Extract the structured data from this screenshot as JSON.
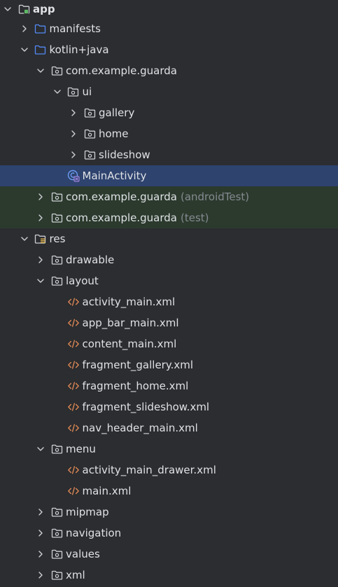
{
  "tree": [
    {
      "label": "app",
      "suffix": "",
      "depth": 0,
      "state": "expanded",
      "icon": "module-folder-icon",
      "style": "bold"
    },
    {
      "label": "manifests",
      "suffix": "",
      "depth": 1,
      "state": "collapsed",
      "icon": "blue-folder-icon",
      "style": ""
    },
    {
      "label": "kotlin+java",
      "suffix": "",
      "depth": 1,
      "state": "expanded",
      "icon": "blue-folder-icon",
      "style": ""
    },
    {
      "label": "com.example.guarda",
      "suffix": "",
      "depth": 2,
      "state": "expanded",
      "icon": "package-folder-icon",
      "style": ""
    },
    {
      "label": "ui",
      "suffix": "",
      "depth": 3,
      "state": "expanded",
      "icon": "package-folder-icon",
      "style": ""
    },
    {
      "label": "gallery",
      "suffix": "",
      "depth": 4,
      "state": "collapsed",
      "icon": "package-folder-icon",
      "style": ""
    },
    {
      "label": "home",
      "suffix": "",
      "depth": 4,
      "state": "collapsed",
      "icon": "package-folder-icon",
      "style": ""
    },
    {
      "label": "slideshow",
      "suffix": "",
      "depth": 4,
      "state": "collapsed",
      "icon": "package-folder-icon",
      "style": ""
    },
    {
      "label": "MainActivity",
      "suffix": "",
      "depth": 3,
      "state": "leaf",
      "icon": "kotlin-class-icon",
      "style": "selected"
    },
    {
      "label": "com.example.guarda",
      "suffix": "(androidTest)",
      "depth": 2,
      "state": "collapsed",
      "icon": "package-folder-icon",
      "style": "tinted"
    },
    {
      "label": "com.example.guarda",
      "suffix": "(test)",
      "depth": 2,
      "state": "collapsed",
      "icon": "package-folder-icon",
      "style": "tinted"
    },
    {
      "label": "res",
      "suffix": "",
      "depth": 1,
      "state": "expanded",
      "icon": "resources-folder-icon",
      "style": ""
    },
    {
      "label": "drawable",
      "suffix": "",
      "depth": 2,
      "state": "collapsed",
      "icon": "package-folder-icon",
      "style": ""
    },
    {
      "label": "layout",
      "suffix": "",
      "depth": 2,
      "state": "expanded",
      "icon": "package-folder-icon",
      "style": ""
    },
    {
      "label": "activity_main.xml",
      "suffix": "",
      "depth": 3,
      "state": "leaf",
      "icon": "xml-file-icon",
      "style": ""
    },
    {
      "label": "app_bar_main.xml",
      "suffix": "",
      "depth": 3,
      "state": "leaf",
      "icon": "xml-file-icon",
      "style": ""
    },
    {
      "label": "content_main.xml",
      "suffix": "",
      "depth": 3,
      "state": "leaf",
      "icon": "xml-file-icon",
      "style": ""
    },
    {
      "label": "fragment_gallery.xml",
      "suffix": "",
      "depth": 3,
      "state": "leaf",
      "icon": "xml-file-icon",
      "style": ""
    },
    {
      "label": "fragment_home.xml",
      "suffix": "",
      "depth": 3,
      "state": "leaf",
      "icon": "xml-file-icon",
      "style": ""
    },
    {
      "label": "fragment_slideshow.xml",
      "suffix": "",
      "depth": 3,
      "state": "leaf",
      "icon": "xml-file-icon",
      "style": ""
    },
    {
      "label": "nav_header_main.xml",
      "suffix": "",
      "depth": 3,
      "state": "leaf",
      "icon": "xml-file-icon",
      "style": ""
    },
    {
      "label": "menu",
      "suffix": "",
      "depth": 2,
      "state": "expanded",
      "icon": "package-folder-icon",
      "style": ""
    },
    {
      "label": "activity_main_drawer.xml",
      "suffix": "",
      "depth": 3,
      "state": "leaf",
      "icon": "xml-file-icon",
      "style": ""
    },
    {
      "label": "main.xml",
      "suffix": "",
      "depth": 3,
      "state": "leaf",
      "icon": "xml-file-icon",
      "style": ""
    },
    {
      "label": "mipmap",
      "suffix": "",
      "depth": 2,
      "state": "collapsed",
      "icon": "package-folder-icon",
      "style": ""
    },
    {
      "label": "navigation",
      "suffix": "",
      "depth": 2,
      "state": "collapsed",
      "icon": "package-folder-icon",
      "style": ""
    },
    {
      "label": "values",
      "suffix": "",
      "depth": 2,
      "state": "collapsed",
      "icon": "package-folder-icon",
      "style": ""
    },
    {
      "label": "xml",
      "suffix": "",
      "depth": 2,
      "state": "collapsed",
      "icon": "package-folder-icon",
      "style": ""
    }
  ],
  "colors": {
    "background": "#2b2d30",
    "selected_row": "#2e436e",
    "test_source_row": "#2b3a2d",
    "folder_blue": "#548af7",
    "folder_gray": "#ced0d6",
    "module_green": "#5fb865",
    "xml_orange": "#e08855",
    "kotlin_purple": "#b48ff0",
    "suffix_gray": "#868a91"
  }
}
